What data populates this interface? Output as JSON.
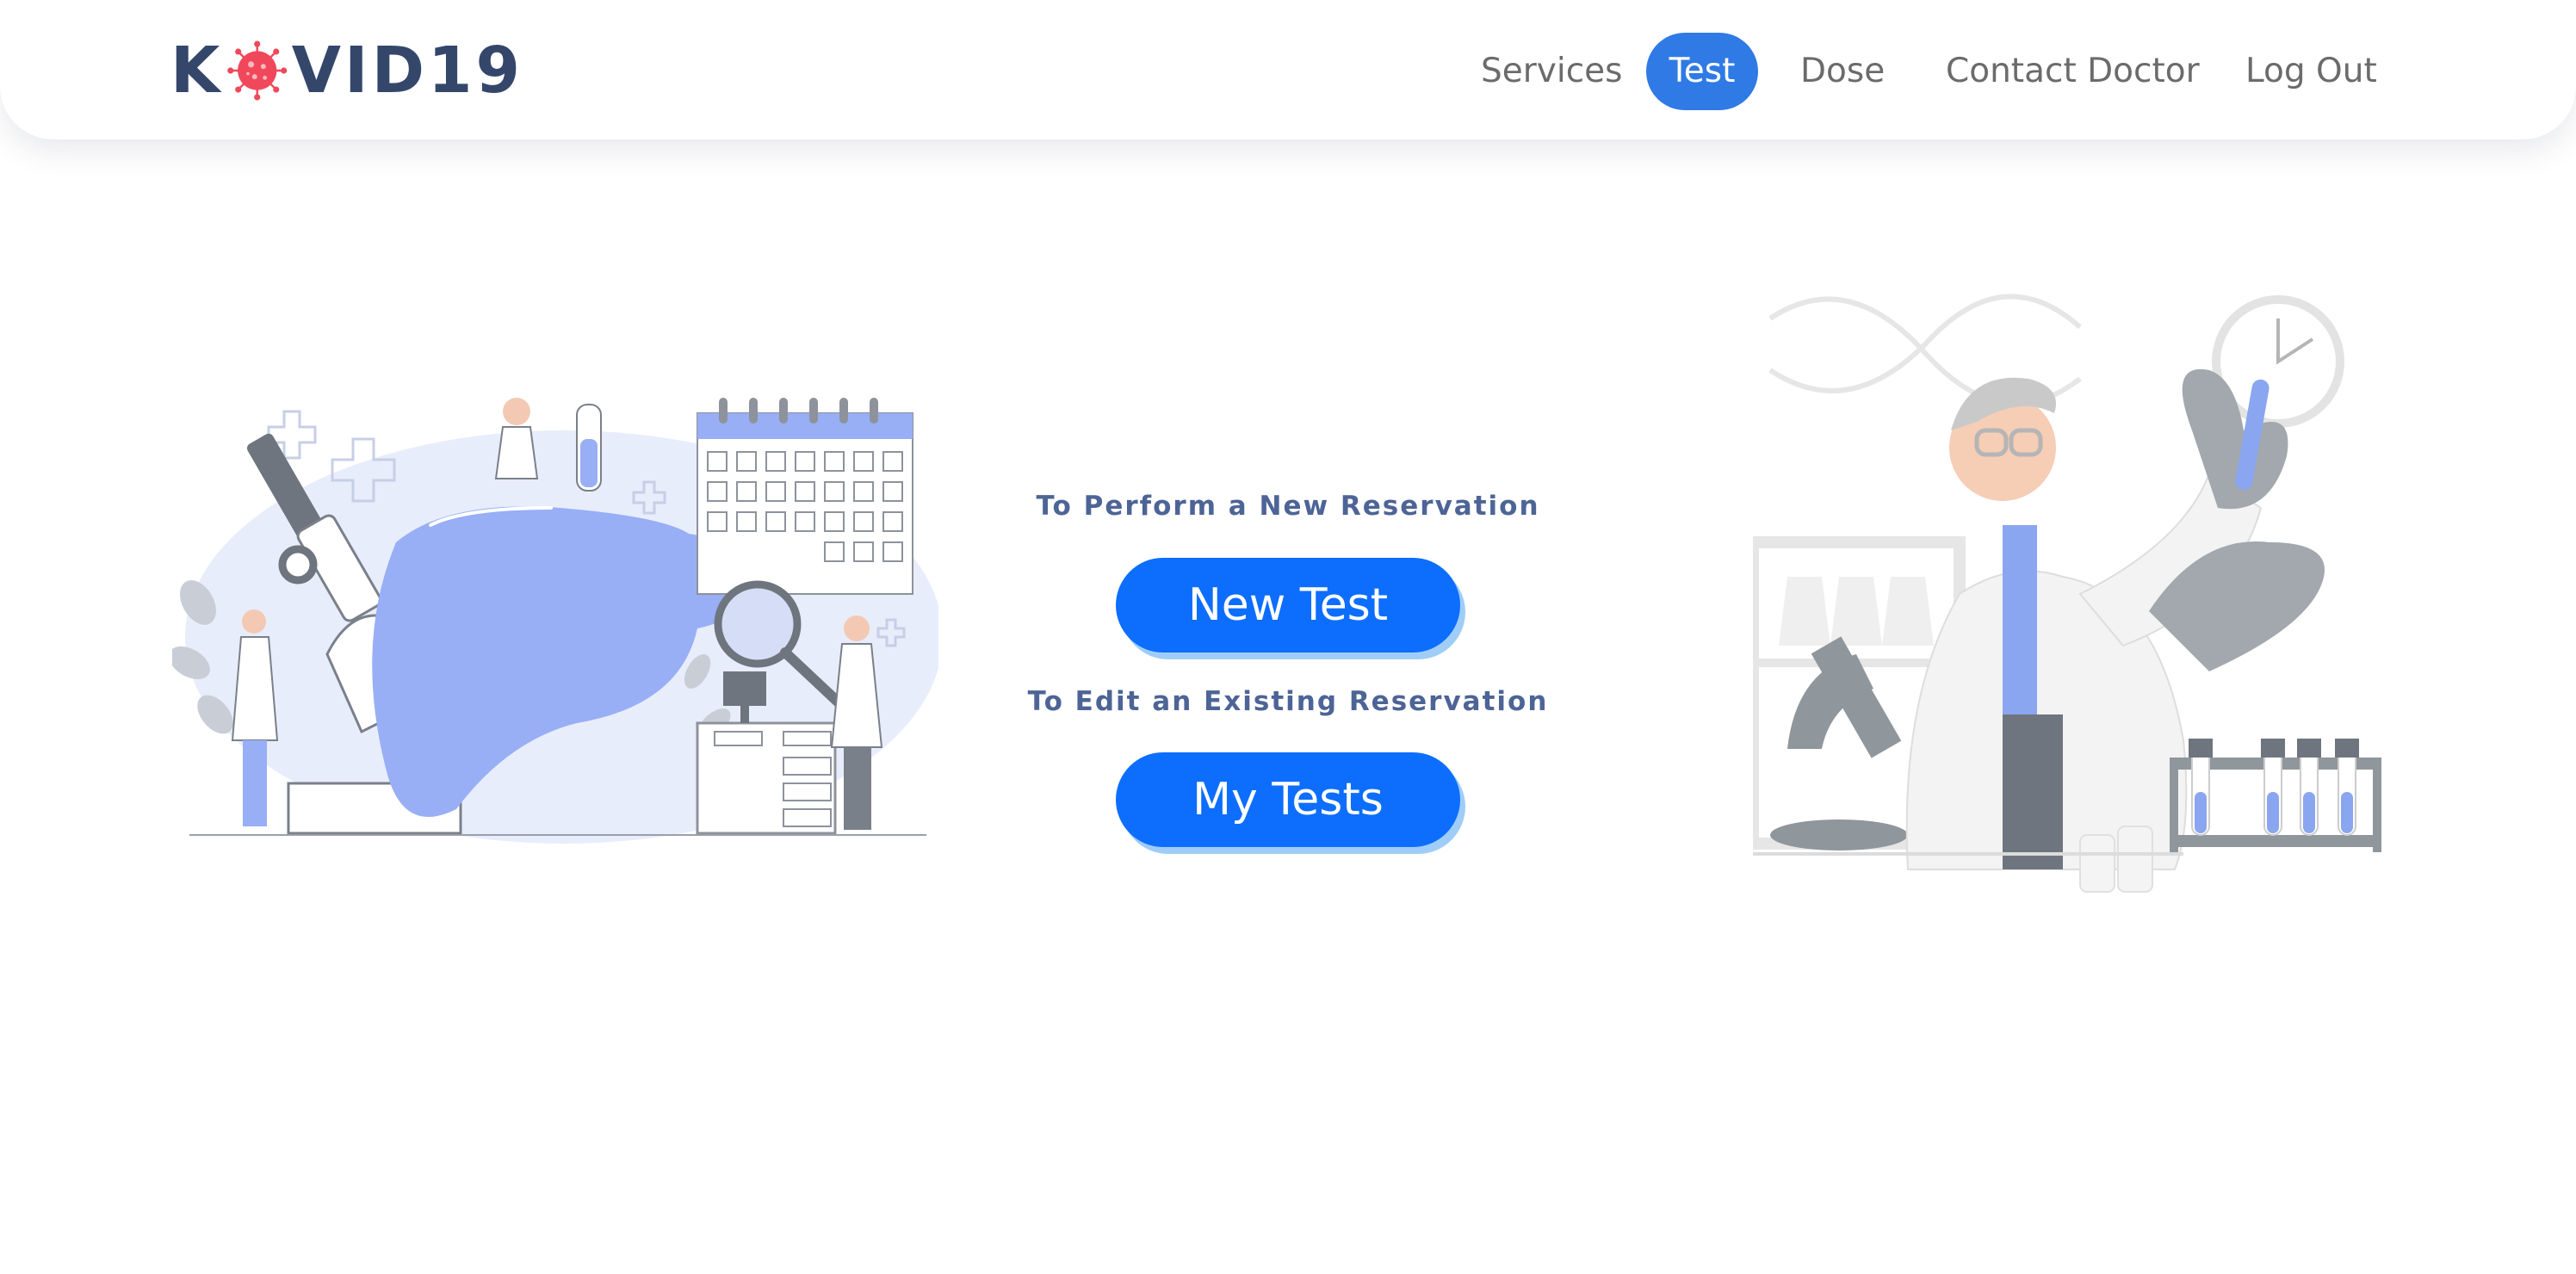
{
  "brand": {
    "logo_prefix": "K",
    "logo_suffix": "VID19",
    "text_color": "#34476b",
    "virus_color": "#f0485a"
  },
  "nav": {
    "items": [
      {
        "label": "Services",
        "active": false
      },
      {
        "label": "Test",
        "active": true
      },
      {
        "label": "Dose",
        "active": false
      },
      {
        "label": "Contact Doctor",
        "active": false
      },
      {
        "label": "Log Out",
        "active": false
      }
    ],
    "active_color": "#2f7ae5"
  },
  "main": {
    "new_reservation_text": "To Perform a New Reservation",
    "new_test_button": "New Test",
    "edit_reservation_text": "To Edit an Existing Reservation",
    "my_tests_button": "My Tests",
    "button_color": "#0d6efd"
  },
  "illustrations": {
    "left": "lab-research-illustration",
    "right": "scientist-test-tube-illustration"
  }
}
